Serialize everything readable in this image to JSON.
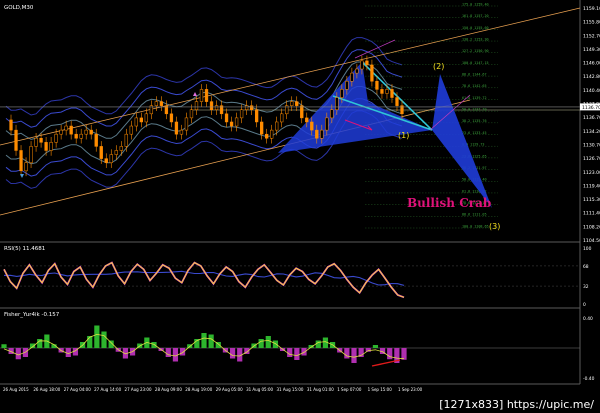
{
  "window": {
    "symbol_title": "GOLD,M30"
  },
  "pattern": {
    "name": "Bullish Crab",
    "points": [
      "(1)",
      "(2)",
      "(3)"
    ]
  },
  "indicators": [
    {
      "name": "RSI(5) 11.4681"
    },
    {
      "name": "Fisher_Yur4ik -0.157"
    }
  ],
  "colors": {
    "background": "#000000",
    "candle": "#ff8c00",
    "pattern_fill": "#1f3cd8",
    "pattern_line": "#2ec4d6",
    "bollinger": "#3a4acf",
    "channel": "#e8a050",
    "pattern_label": "#e0127a",
    "fib_text": "#3da83d",
    "rsi_line": "#f5e020",
    "fisher_hist": "#2db52d",
    "fisher_neg": "#b02fb0"
  },
  "watermark": "[1271x833] https://upic.me/",
  "chart_data": [
    {
      "type": "line",
      "title": "GOLD,M30",
      "ylim": [
        1105,
        1160
      ],
      "y_ticks": [
        "1159.10",
        "1155.80",
        "1152.70",
        "1149.30",
        "1146.00",
        "1142.80",
        "1140.40",
        "1137.90",
        "1136.70",
        "1134.20",
        "1130.70",
        "1126.70",
        "1123.00",
        "1119.40",
        "1115.30",
        "1111.40",
        "1108.20",
        "1104.50"
      ],
      "current_price": "1136.70",
      "x_ticks": [
        "26 Aug 2015",
        "26 Aug 18:00",
        "27 Aug 04:00",
        "27 Aug 14:00",
        "27 Aug 23:00",
        "28 Aug 09:00",
        "28 Aug 19:00",
        "29 Aug 05:00",
        "31 Aug 05:00",
        "31 Aug 15:00",
        "31 Aug 01:00",
        "1 Sep 07:00",
        "1 Sep 15:00",
        "1 Sep 23:00"
      ],
      "fib_levels": [
        "175.0 1159.40",
        "161.8 1157.20",
        "150.0 1155.60",
        "138.2 1153.30",
        "127.2 1150.90",
        "100.0 1147.15",
        "88.6 1144.67",
        "78.6 1142.65",
        "61.8 1139.72",
        "50.0 1137.70",
        "38.2 1135.76",
        "23.6 1133.45",
        "0.0 1129.73",
        "23.6 1125.65",
        "38.2 1121.97",
        "50.0 1119.40",
        "61.8 1116.82",
        "78.6 1113.15",
        "88.6 1111.05",
        "100.0 1108.65"
      ],
      "price_series": [
        1133.5,
        1131,
        1126,
        1121,
        1123,
        1127,
        1129,
        1128,
        1126,
        1128,
        1130,
        1131,
        1132,
        1130,
        1129,
        1130,
        1131,
        1130,
        1127,
        1124,
        1123,
        1125,
        1126,
        1127,
        1130,
        1132,
        1134,
        1133,
        1135,
        1137,
        1138,
        1137,
        1135,
        1133,
        1130,
        1131,
        1134,
        1136,
        1138,
        1141,
        1138,
        1136,
        1137,
        1135,
        1133,
        1132,
        1134,
        1136,
        1137,
        1136,
        1133,
        1130,
        1129,
        1131,
        1133,
        1135,
        1137,
        1138,
        1137,
        1134,
        1133,
        1131,
        1129,
        1131,
        1134,
        1136,
        1139,
        1141,
        1143,
        1145,
        1146,
        1148,
        1147,
        1143,
        1141,
        1140,
        1141,
        1139,
        1137,
        1135
      ]
    },
    {
      "type": "line",
      "title": "RSI(5) 11.4681",
      "ylim": [
        0,
        100
      ],
      "y_ticks": [
        "100",
        "68",
        "32",
        "0"
      ],
      "series": [
        {
          "name": "RSI(5)",
          "values": [
            62,
            40,
            28,
            55,
            70,
            52,
            38,
            60,
            72,
            48,
            35,
            58,
            66,
            44,
            30,
            52,
            68,
            74,
            50,
            36,
            58,
            71,
            62,
            42,
            55,
            70,
            64,
            46,
            38,
            60,
            74,
            68,
            50,
            36,
            54,
            66,
            58,
            40,
            30,
            48,
            62,
            70,
            56,
            42,
            34,
            52,
            64,
            58,
            44,
            36,
            50,
            66,
            72,
            60,
            44,
            30,
            20,
            38,
            52,
            62,
            46,
            30,
            16,
            12
          ]
        }
      ]
    },
    {
      "type": "bar",
      "title": "Fisher_Yur4ik -0.157",
      "ylim": [
        -0.4,
        0.4
      ],
      "y_ticks": [
        "0.40",
        "-0.40"
      ],
      "series": [
        {
          "name": "Fisher_Yur4ik",
          "values": [
            0.05,
            -0.08,
            -0.15,
            -0.12,
            0.06,
            0.12,
            0.18,
            0.05,
            -0.06,
            -0.12,
            -0.1,
            0.08,
            0.16,
            0.3,
            0.22,
            0.1,
            -0.05,
            -0.14,
            -0.1,
            0.06,
            0.14,
            0.08,
            -0.04,
            -0.12,
            -0.18,
            -0.1,
            0.05,
            0.12,
            0.2,
            0.18,
            0.08,
            -0.06,
            -0.14,
            -0.18,
            -0.08,
            0.06,
            0.12,
            0.16,
            0.1,
            -0.04,
            -0.12,
            -0.16,
            -0.1,
            0.04,
            0.1,
            0.14,
            0.08,
            -0.06,
            -0.14,
            -0.2,
            -0.12,
            -0.05,
            0.04,
            -0.08,
            -0.15,
            -0.2,
            -0.157
          ]
        }
      ]
    }
  ]
}
